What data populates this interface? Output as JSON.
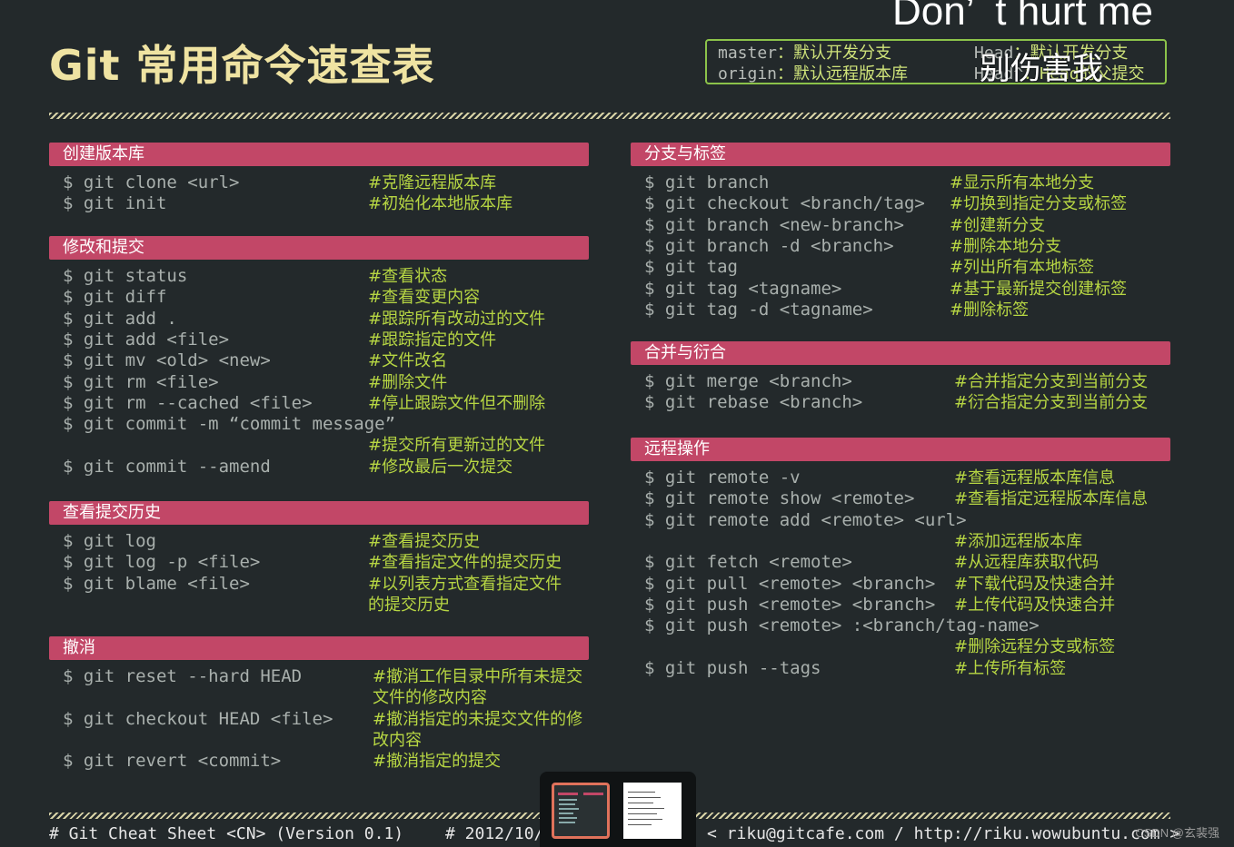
{
  "title": "Git 常用命令速查表",
  "overlay_en": "Don’  t hurt me",
  "overlay_cn": "别伤害我",
  "legend": {
    "left": [
      {
        "key": "master",
        "value": "：默认开发分支"
      },
      {
        "key": "origin",
        "value": "：默认远程版本库"
      }
    ],
    "right": [
      {
        "key": "Head",
        "value": "：默认开发分支"
      },
      {
        "key": "Head^",
        "value": "：Head的父提交"
      }
    ]
  },
  "sections": {
    "create": {
      "title": "创建版本库",
      "rows": [
        {
          "cmd": "$ git clone <url>",
          "cmt": "#克隆远程版本库"
        },
        {
          "cmd": "$ git init",
          "cmt": "#初始化本地版本库"
        }
      ]
    },
    "modify": {
      "title": "修改和提交",
      "rows": [
        {
          "cmd": "$ git status",
          "cmt": "#查看状态"
        },
        {
          "cmd": "$ git diff",
          "cmt": "#查看变更内容"
        },
        {
          "cmd": "$ git add .",
          "cmt": "#跟踪所有改动过的文件"
        },
        {
          "cmd": "$ git add <file>",
          "cmt": "#跟踪指定的文件"
        },
        {
          "cmd": "$ git mv <old> <new>",
          "cmt": "#文件改名"
        },
        {
          "cmd": "$ git rm <file>",
          "cmt": "#删除文件"
        },
        {
          "cmd": "$ git rm --cached <file>",
          "cmt": "#停止跟踪文件但不删除"
        },
        {
          "cmd": "$ git commit -m “commit message”",
          "cmt": ""
        },
        {
          "cmd": "",
          "cmt": "#提交所有更新过的文件"
        },
        {
          "cmd": "$ git commit --amend",
          "cmt": "#修改最后一次提交"
        }
      ]
    },
    "history": {
      "title": "查看提交历史",
      "rows": [
        {
          "cmd": "$ git log",
          "cmt": "#查看提交历史"
        },
        {
          "cmd": "$ git log -p <file>",
          "cmt": "#查看指定文件的提交历史"
        },
        {
          "cmd": "$ git blame <file>",
          "cmt": "#以列表方式查看指定文件"
        },
        {
          "cmd": "",
          "cmt": "的提交历史"
        }
      ]
    },
    "undo": {
      "title": "撤消",
      "rows": [
        {
          "cmd": "$ git reset --hard HEAD",
          "cmt": "#撤消工作目录中所有未提交"
        },
        {
          "cmd": "",
          "cmt": "文件的修改内容"
        },
        {
          "cmd": "$ git checkout HEAD <file>",
          "cmt": "#撤消指定的未提交文件的修"
        },
        {
          "cmd": "",
          "cmt": "改内容"
        },
        {
          "cmd": "$ git revert <commit>",
          "cmt": "#撤消指定的提交"
        }
      ]
    },
    "branch": {
      "title": "分支与标签",
      "rows": [
        {
          "cmd": "$ git branch",
          "cmt": "#显示所有本地分支"
        },
        {
          "cmd": "$ git checkout <branch/tag>",
          "cmt": "#切换到指定分支或标签"
        },
        {
          "cmd": "$ git branch <new-branch>",
          "cmt": "#创建新分支"
        },
        {
          "cmd": "$ git branch -d <branch>",
          "cmt": "#删除本地分支"
        },
        {
          "cmd": "$ git tag",
          "cmt": "#列出所有本地标签"
        },
        {
          "cmd": "$ git tag <tagname>",
          "cmt": "#基于最新提交创建标签"
        },
        {
          "cmd": "$ git tag -d <tagname>",
          "cmt": "#删除标签"
        }
      ]
    },
    "merge": {
      "title": "合并与衍合",
      "rows": [
        {
          "cmd": "$ git merge <branch>",
          "cmt": "#合并指定分支到当前分支"
        },
        {
          "cmd": "$ git rebase <branch>",
          "cmt": "#衍合指定分支到当前分支"
        }
      ]
    },
    "remote": {
      "title": "远程操作",
      "rows": [
        {
          "cmd": "$ git remote -v",
          "cmt": "#查看远程版本库信息"
        },
        {
          "cmd": "$ git remote show <remote>",
          "cmt": "#查看指定远程版本库信息"
        },
        {
          "cmd": "$ git remote add <remote> <url>",
          "cmt": ""
        },
        {
          "cmd": "",
          "cmt": "#添加远程版本库"
        },
        {
          "cmd": "$ git fetch <remote>",
          "cmt": "#从远程库获取代码"
        },
        {
          "cmd": "$ git pull <remote> <branch>",
          "cmt": "#下载代码及快速合并"
        },
        {
          "cmd": "$ git push <remote> <branch>",
          "cmt": "#上传代码及快速合并"
        },
        {
          "cmd": "$ git push <remote> :<branch/tag-name>",
          "cmt": ""
        },
        {
          "cmd": "",
          "cmt": "#删除远程分支或标签"
        },
        {
          "cmd": "$ git push --tags",
          "cmt": "#上传所有标签"
        }
      ]
    }
  },
  "footer": {
    "left": "# Git Cheat Sheet <CN> (Version 0.1)",
    "mid": "# 2012/10/",
    "right": "< riku@gitcafe.com / http://riku.wowubuntu.com >"
  },
  "watermark": "CSDN @玄裴强"
}
